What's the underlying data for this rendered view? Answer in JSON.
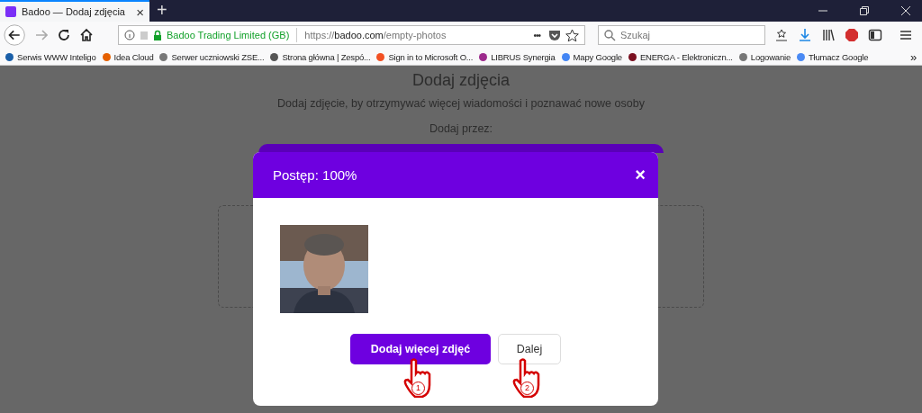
{
  "tab": {
    "title": "Badoo — Dodaj zdjęcia",
    "close": "×",
    "new_tab": "+"
  },
  "address_bar": {
    "identity": "Badoo Trading Limited (GB)",
    "url_prefix": "https://",
    "url_domain": "badoo.com",
    "url_path": "/empty-photos",
    "more": "•••"
  },
  "search": {
    "placeholder": "Szukaj"
  },
  "bookmarks": [
    {
      "label": "Serwis WWW Inteligo",
      "color": "#1a5fa8"
    },
    {
      "label": "Idea Cloud",
      "color": "#e66000"
    },
    {
      "label": "Serwer uczniowski ZSE...",
      "color": "#777777"
    },
    {
      "label": "Strona główna | Zespó...",
      "color": "#555555"
    },
    {
      "label": "Sign in to Microsoft O...",
      "color": "#f25022"
    },
    {
      "label": "LIBRUS Synergia",
      "color": "#9c2a8c"
    },
    {
      "label": "Mapy Google",
      "color": "#4285f4"
    },
    {
      "label": "ENERGA - Elektroniczn...",
      "color": "#7a1020"
    },
    {
      "label": "Logowanie",
      "color": "#777777"
    },
    {
      "label": "Tłumacz Google",
      "color": "#4a8af4"
    }
  ],
  "bookmarks_more": "»",
  "page": {
    "title": "Dodaj zdjęcia",
    "subtitle": "Dodaj zdjęcie, by otrzymywać więcej wiadomości i poznawać nowe osoby",
    "add_via": "Dodaj przez:"
  },
  "modal": {
    "title": "Postęp: 100%",
    "close": "×",
    "buttons": [
      {
        "label": "Dodaj więcej zdjęć",
        "kind": "primary",
        "marker": "1"
      },
      {
        "label": "Dalej",
        "kind": "secondary",
        "marker": "2"
      }
    ]
  }
}
